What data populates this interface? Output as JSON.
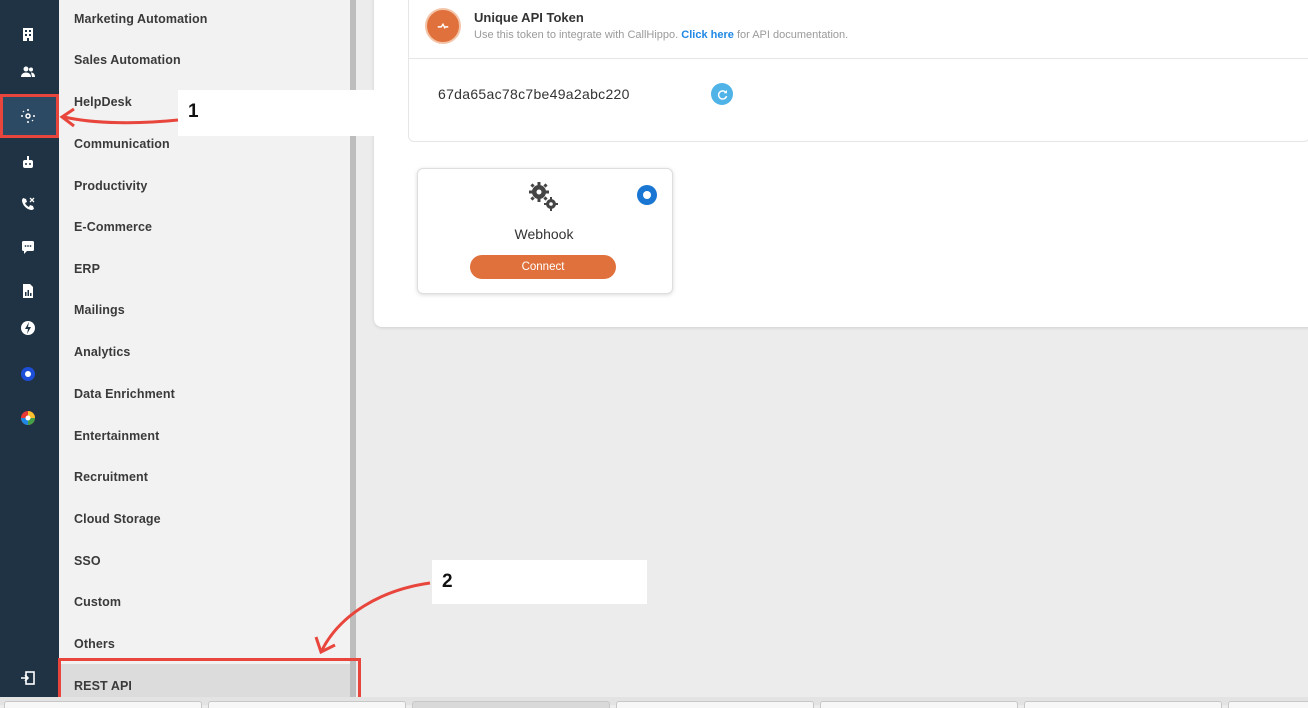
{
  "rail": {
    "icons": [
      "building-icon",
      "users-icon",
      "integrations-icon",
      "robot-icon",
      "phone-call-icon",
      "chat-icon",
      "report-icon",
      "bolt-icon",
      "circle-app-icon",
      "color-wheel-icon",
      "logout-icon"
    ]
  },
  "categories": [
    "Marketing Automation",
    "Sales Automation",
    "HelpDesk",
    "Communication",
    "Productivity",
    "E-Commerce",
    "ERP",
    "Mailings",
    "Analytics",
    "Data Enrichment",
    "Entertainment",
    "Recruitment",
    "Cloud Storage",
    "SSO",
    "Custom",
    "Others",
    "REST API"
  ],
  "token": {
    "title": "Unique API Token",
    "desc_before": "Use this token to integrate with CallHippo.",
    "desc_link": "Click here",
    "desc_after": "for API documentation.",
    "value": "67da65ac78c7be49a2abc220"
  },
  "webhook": {
    "label": "Webhook",
    "connect_label": "Connect"
  },
  "annotations": {
    "one": "1",
    "two": "2"
  },
  "colors": {
    "accent": "#e0713c",
    "annotation": "#e8463c",
    "rail": "#1f3344",
    "link": "#1e88e5"
  }
}
